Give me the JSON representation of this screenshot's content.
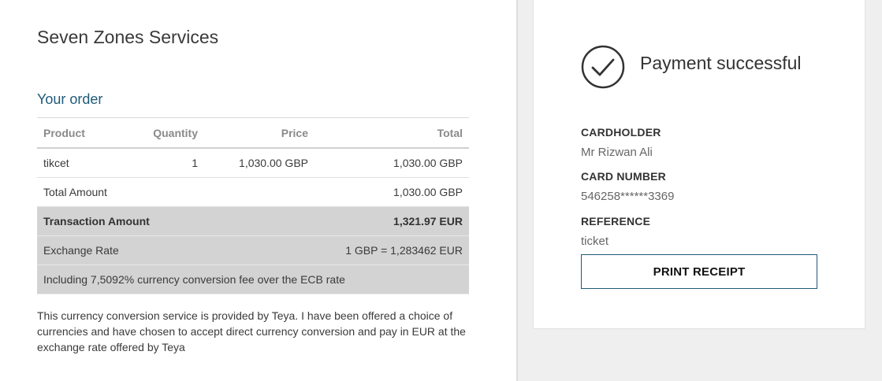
{
  "merchant": {
    "name": "Seven Zones Services"
  },
  "order": {
    "title": "Your order",
    "headers": {
      "product": "Product",
      "quantity": "Quantity",
      "price": "Price",
      "total": "Total"
    },
    "items": [
      {
        "product": "tikcet",
        "quantity": "1",
        "price": "1,030.00 GBP",
        "total": "1,030.00 GBP"
      }
    ],
    "total_amount": {
      "label": "Total Amount",
      "value": "1,030.00 GBP"
    },
    "transaction_amount": {
      "label": "Transaction Amount",
      "value": "1,321.97 EUR"
    },
    "exchange_rate": {
      "label": "Exchange Rate",
      "value": "1 GBP = 1,283462 EUR"
    },
    "fee_note": "Including 7,5092% currency conversion fee over the ECB rate"
  },
  "disclaimer": "This currency conversion service is provided by Teya. I have been offered a choice of currencies and have chosen to accept direct currency conversion and pay in EUR at the exchange rate offered by Teya",
  "payment": {
    "status": "Payment successful",
    "status_icon": "check-circle-icon",
    "cardholder_label": "CARDHOLDER",
    "cardholder": "Mr Rizwan Ali",
    "card_number_label": "CARD NUMBER",
    "card_number": "546258******3369",
    "reference_label": "REFERENCE",
    "reference": "ticket",
    "print_button": "PRINT RECEIPT"
  },
  "colors": {
    "accent": "#1f5a78",
    "grey_row": "#d3d3d3",
    "right_panel_bg": "#efefef"
  }
}
